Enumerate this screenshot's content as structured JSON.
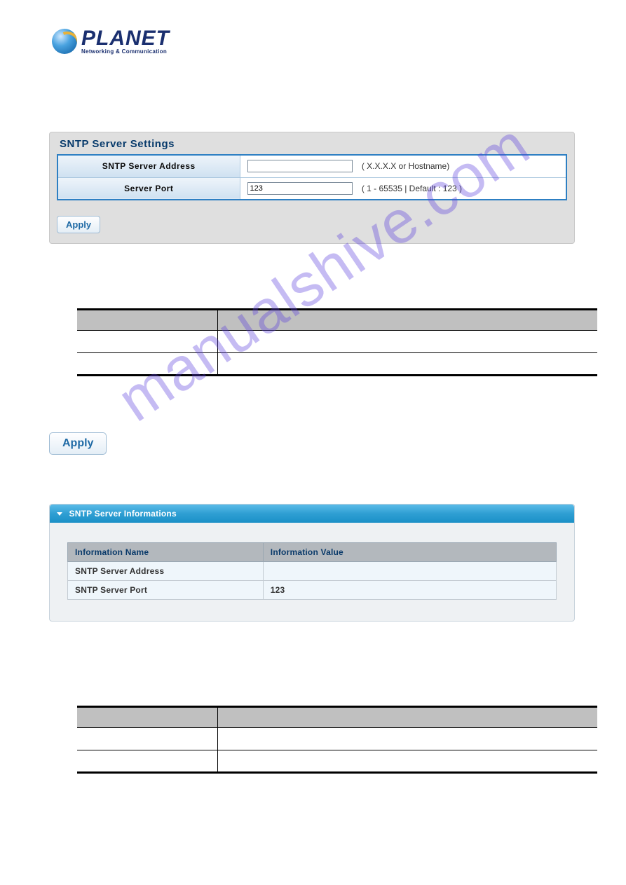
{
  "logo": {
    "brand": "PLANET",
    "tagline": "Networking & Communication"
  },
  "settings": {
    "title": "SNTP Server Settings",
    "rows": {
      "address": {
        "label": "SNTP Server Address",
        "value": "",
        "hint": "( X.X.X.X or Hostname)"
      },
      "port": {
        "label": "Server Port",
        "value": "123",
        "hint": "( 1 - 65535 | Default : 123 )"
      }
    },
    "apply_label": "Apply"
  },
  "apply2_label": "Apply",
  "info_panel": {
    "header": "SNTP Server Informations",
    "headers": {
      "name": "Information Name",
      "value": "Information Value"
    },
    "rows": [
      {
        "name": "SNTP Server Address",
        "value": ""
      },
      {
        "name": "SNTP Server Port",
        "value": "123"
      }
    ]
  },
  "watermark": "manualshive.com"
}
